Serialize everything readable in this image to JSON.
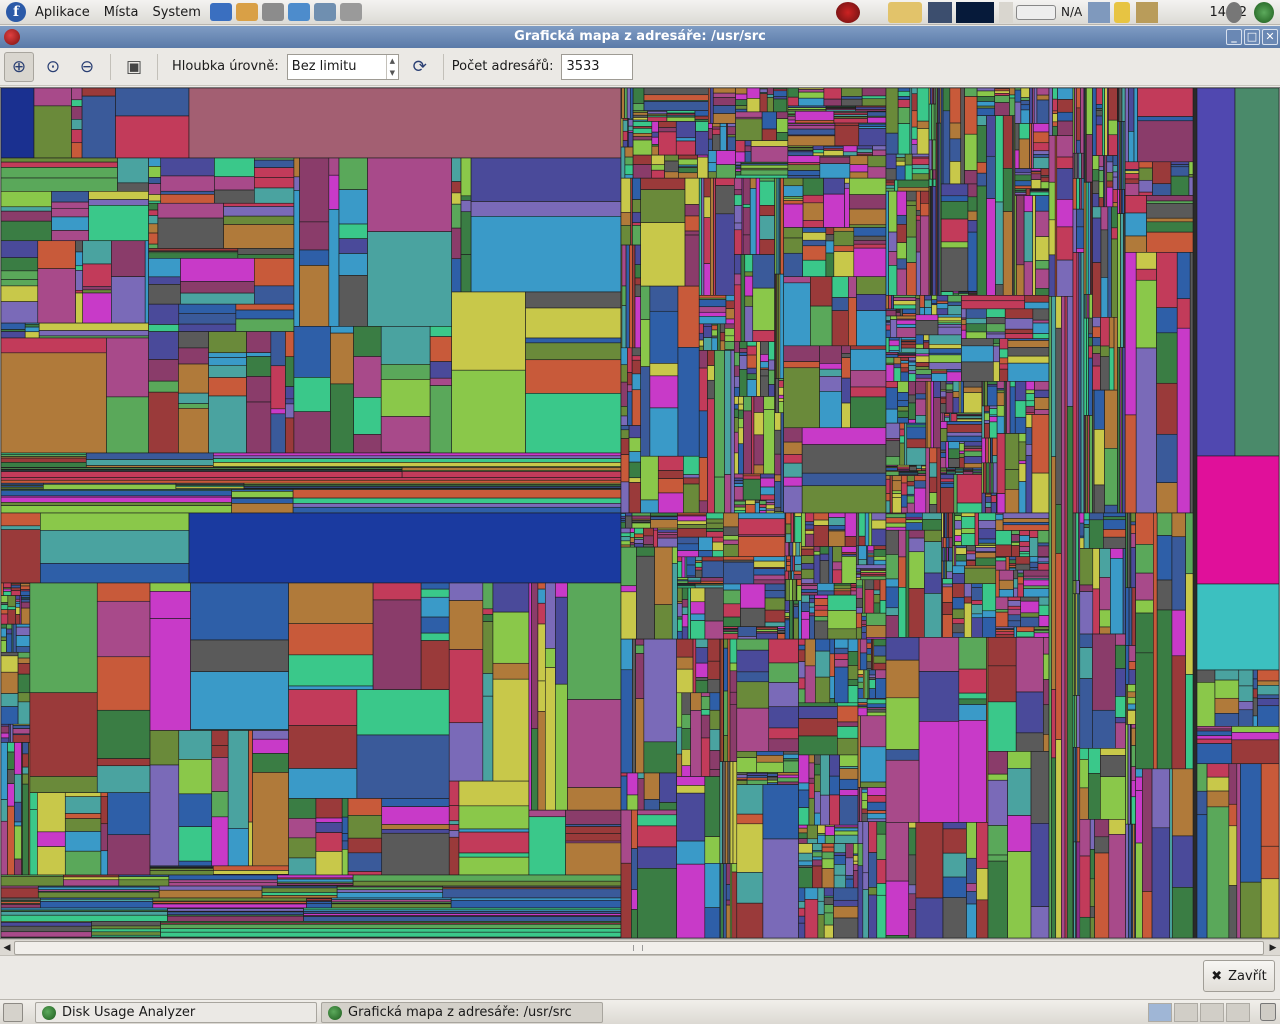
{
  "top_panel": {
    "menus": [
      "Aplikace",
      "Místa",
      "System"
    ],
    "battery_text": "N/A",
    "clock": "14:12"
  },
  "window": {
    "title": "Grafická mapa z adresáře: /usr/src"
  },
  "toolbar": {
    "depth_label": "Hloubka úrovně:",
    "depth_value": "Bez limitu",
    "dir_count_label": "Počet adresářů:",
    "dir_count_value": "3533"
  },
  "close_button": {
    "label": "Zavřít"
  },
  "taskbar": {
    "tasks": [
      "Disk Usage Analyzer",
      "Grafická mapa z adresáře: /usr/src"
    ]
  },
  "colors": {
    "title_bar": "#5a7aa8",
    "treemap_pink_block": "#a35f72",
    "treemap_blue_block": "#1a3aa0",
    "treemap_magenta_block": "#e0109a",
    "treemap_teal_block": "#3cc0c0",
    "treemap_purple_block": "#5048b0"
  }
}
